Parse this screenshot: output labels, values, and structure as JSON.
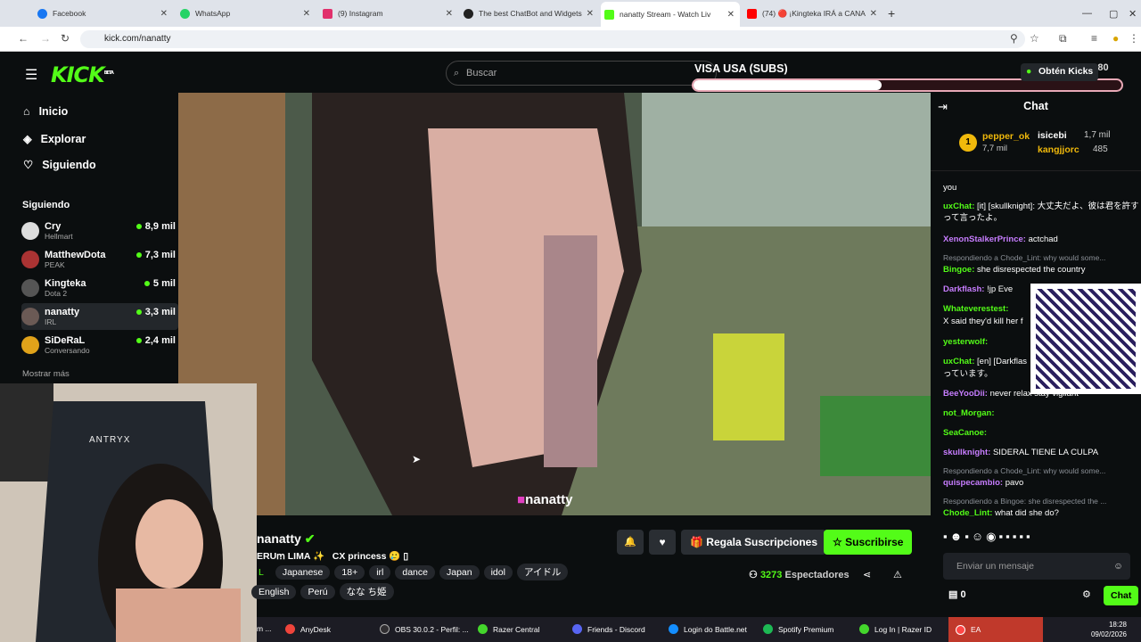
{
  "browser": {
    "tabs": [
      {
        "label": "Facebook",
        "color": "#1877f2"
      },
      {
        "label": "WhatsApp",
        "color": "#25d366"
      },
      {
        "label": "(9) Instagram",
        "color": "#e1306c"
      },
      {
        "label": "The best ChatBot and Widgets",
        "color": "#222"
      },
      {
        "label": "nanatty Stream - Watch Liv",
        "color": "#53fc18"
      },
      {
        "label": "(74) 🔴 ¡Kingteka IRÁ a CANA",
        "color": "#ff0000"
      }
    ],
    "new_tab": "+",
    "url": "kick.com/nanatty"
  },
  "kick": {
    "logo": "KICK",
    "logo_badge": "BETA",
    "search_placeholder": "Buscar",
    "get_kicks": "Obtén Kicks",
    "nav": [
      {
        "label": "Inicio"
      },
      {
        "label": "Explorar"
      },
      {
        "label": "Siguiendo"
      }
    ],
    "following_title": "Siguiendo",
    "channels": [
      {
        "name": "Cry",
        "sub": "Hellmart",
        "viewers": "8,9 mil"
      },
      {
        "name": "MatthewDota",
        "sub": "PEAK",
        "viewers": "7,3 mil"
      },
      {
        "name": "Kingteka",
        "sub": "Dota 2",
        "viewers": "5 mil"
      },
      {
        "name": "nanatty",
        "sub": "IRL",
        "viewers": "3,3 mil"
      },
      {
        "name": "SiDeRaL",
        "sub": "Conversando",
        "viewers": "2,4 mil"
      }
    ],
    "show_more": "Mostrar más"
  },
  "overlay": {
    "goal_title": "VISA USA (SUBS)",
    "goal_count": "35 / 80",
    "goal_progress": 0.44,
    "watermark": "nanatty",
    "camera_brand": "ANTRYX"
  },
  "stream": {
    "title": "nanatty",
    "line2_prefix": "ERUꭑ LIMA ✨",
    "line2_tag": "CX princess 🥲 ▯",
    "tags_row1": [
      "L",
      "Japanese",
      "18+",
      "irl",
      "dance",
      "Japan",
      "idol",
      "アイドル"
    ],
    "tags_row2": [
      "English",
      "Perú",
      "なな ち姫"
    ],
    "gift_button": "Regala Suscripciones",
    "subscribe_button": "Suscribirse",
    "viewers": "3273",
    "viewers_label": "Espectadores"
  },
  "chat": {
    "title": "Chat",
    "top_gifters": [
      {
        "rank": "1",
        "name": "pepper_ok",
        "amount": "7,7 mil"
      },
      {
        "name": "isicebi",
        "amount": "1,7 mil"
      },
      {
        "name": "kangjjorc",
        "amount": "485"
      }
    ],
    "messages": [
      {
        "user": "",
        "text": "you",
        "color": "#fff"
      },
      {
        "user": "uxChat:",
        "text": "[it] [skullknight]: 大丈夫だよ、彼は君を許すって言ったよ。",
        "color": "#53fc18"
      },
      {
        "user": "XenonStalkerPrince:",
        "text": "actchad",
        "color": "#c77dff"
      },
      {
        "reply": "Respondiendo a Chode_Lint: why would some..."
      },
      {
        "user": "Bingoe:",
        "text": "she disrespected the country",
        "color": "#53fc18"
      },
      {
        "user": "Darkflash:",
        "text": "!jp Eve",
        "color": "#c77dff"
      },
      {
        "user": "Whateverestest:",
        "text": "",
        "color": "#53fc18"
      },
      {
        "user": "",
        "text": "X said they'd kill her f",
        "color": "#fff"
      },
      {
        "user": "yesterwolf:",
        "text": "",
        "color": "#53fc18"
      },
      {
        "user": "uxChat:",
        "text": "[en] [Darkflas",
        "color": "#53fc18"
      },
      {
        "user": "",
        "text": "っています。",
        "color": "#fff"
      },
      {
        "user": "BeeYooDii:",
        "text": "never relax stay vigilant",
        "color": "#c77dff"
      },
      {
        "user": "not_Morgan:",
        "text": "",
        "color": "#53fc18"
      },
      {
        "user": "SeaCanoe:",
        "text": "",
        "color": "#53fc18"
      },
      {
        "user": "skullknight:",
        "text": "SIDERAL TIENE LA CULPA",
        "color": "#c77dff"
      },
      {
        "reply": "Respondiendo a Chode_Lint: why would some..."
      },
      {
        "user": "quispecambio:",
        "text": "pavo",
        "color": "#c77dff"
      },
      {
        "reply": "Respondiendo a Bingoe: she disrespected the ..."
      },
      {
        "user": "Chode_Lint:",
        "text": "what did she do?",
        "color": "#53fc18"
      }
    ],
    "input_placeholder": "Enviar un mensaje",
    "points": "0",
    "send_button": "Chat"
  },
  "taskbar": {
    "items": [
      {
        "label": "m ...",
        "color": "#888"
      },
      {
        "label": "AnyDesk",
        "color": "#ef443b"
      },
      {
        "label": "OBS 30.0.2 - Perfil: ...",
        "color": "#302e31"
      },
      {
        "label": "Razer Central",
        "color": "#44d62c"
      },
      {
        "label": "Friends - Discord",
        "color": "#5865f2"
      },
      {
        "label": "Login do Battle.net",
        "color": "#148eff"
      },
      {
        "label": "Spotify Premium",
        "color": "#1db954"
      },
      {
        "label": "Log In | Razer ID",
        "color": "#44d62c"
      },
      {
        "label": "EA",
        "color": "#ff4747"
      }
    ],
    "time": "18:28",
    "date": "09/02/2026"
  },
  "accent": "#53fc18"
}
